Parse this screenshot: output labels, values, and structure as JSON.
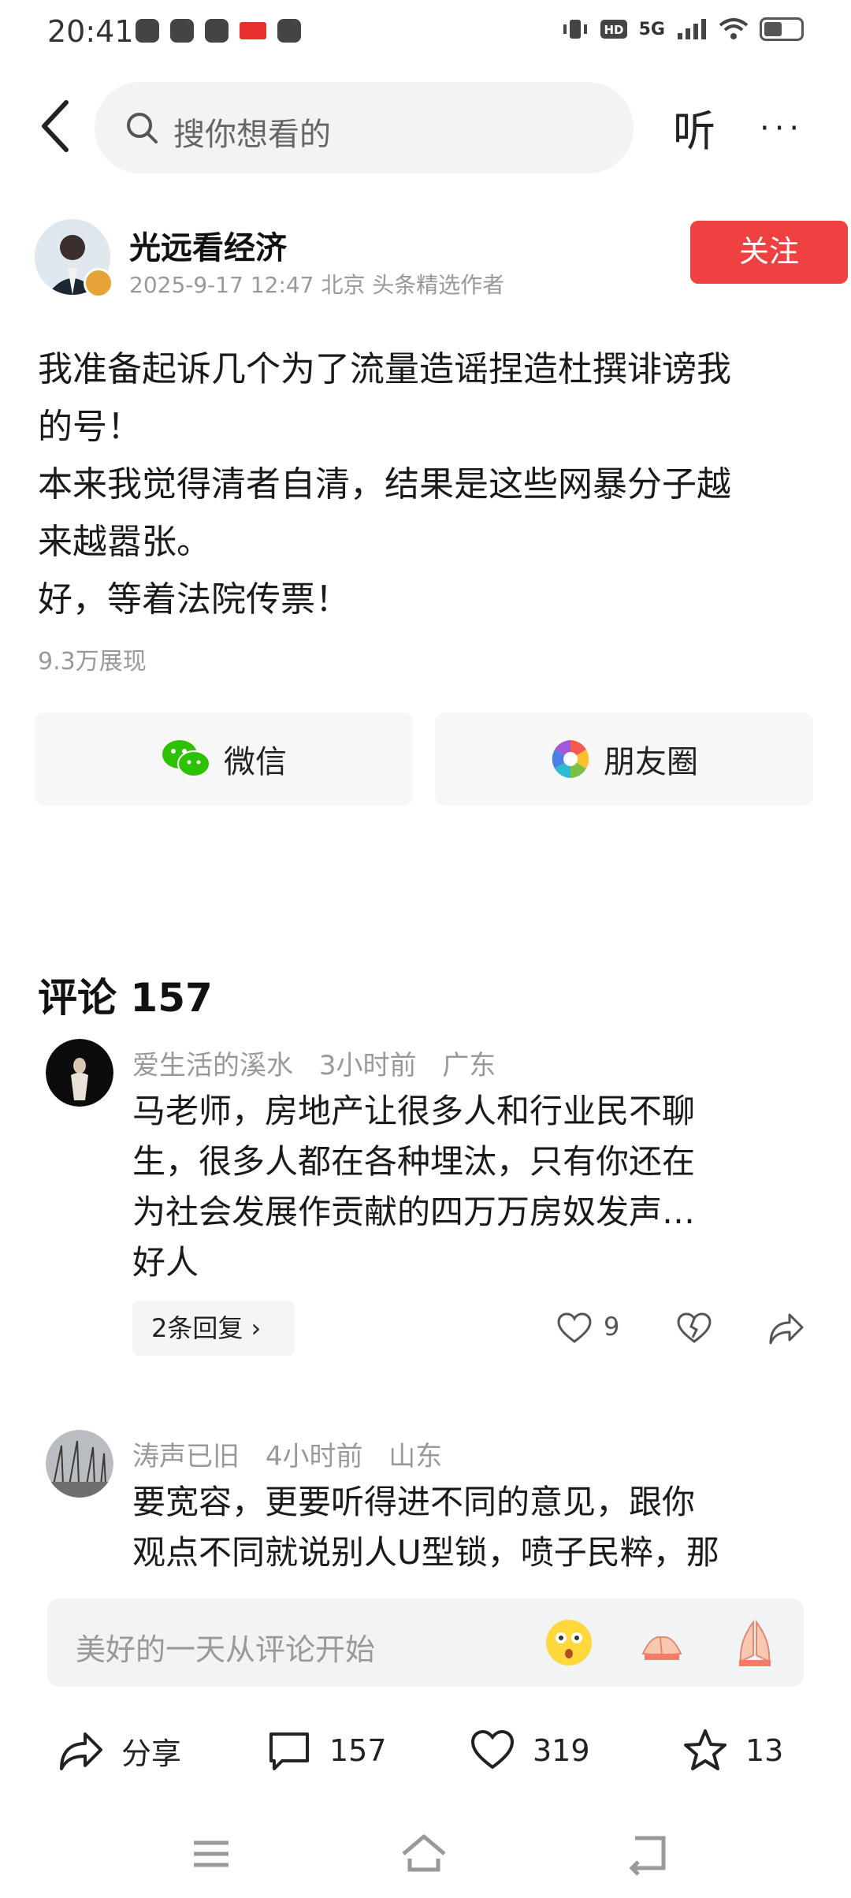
{
  "status_bar": {
    "time": "20:41",
    "network": "5G"
  },
  "header": {
    "search_placeholder": "搜你想看的",
    "listen_label": "听",
    "more_label": "···"
  },
  "author": {
    "name": "光远看经济",
    "meta": "2025-9-17 12:47 北京 头条精选作者",
    "follow_label": "关注"
  },
  "post": {
    "lines": [
      "我准备起诉几个为了流量造谣捏造杜撰诽谤我",
      "的号！",
      "本来我觉得清者自清，结果是这些网暴分子越",
      "来越嚣张。",
      "好，等着法院传票！"
    ],
    "views": "9.3万展现"
  },
  "share": {
    "wechat_label": "微信",
    "moments_label": "朋友圈"
  },
  "comments_section": {
    "title": "评论 157"
  },
  "comments": [
    {
      "user": "爱生活的溪水",
      "time": "3小时前",
      "location": "广东",
      "lines": [
        "马老师，房地产让很多人和行业民不聊",
        "生，很多人都在各种埋汰，只有你还在",
        "为社会发展作贡献的四万万房奴发声…",
        "好人"
      ],
      "replies_label": "2条回复",
      "likes": "9"
    },
    {
      "user": "涛声已旧",
      "time": "4小时前",
      "location": "山东",
      "lines": [
        "要宽容，更要听得进不同的意见，跟你",
        "观点不同就说别人U型锁，喷子民粹，那"
      ]
    }
  ],
  "input_bar": {
    "placeholder": "美好的一天从评论开始"
  },
  "actions": {
    "share_label": "分享",
    "comment_count": "157",
    "like_count": "319",
    "fav_count": "13"
  },
  "colors": {
    "accent_red": "#f04142",
    "wechat_green": "#2dc100"
  }
}
